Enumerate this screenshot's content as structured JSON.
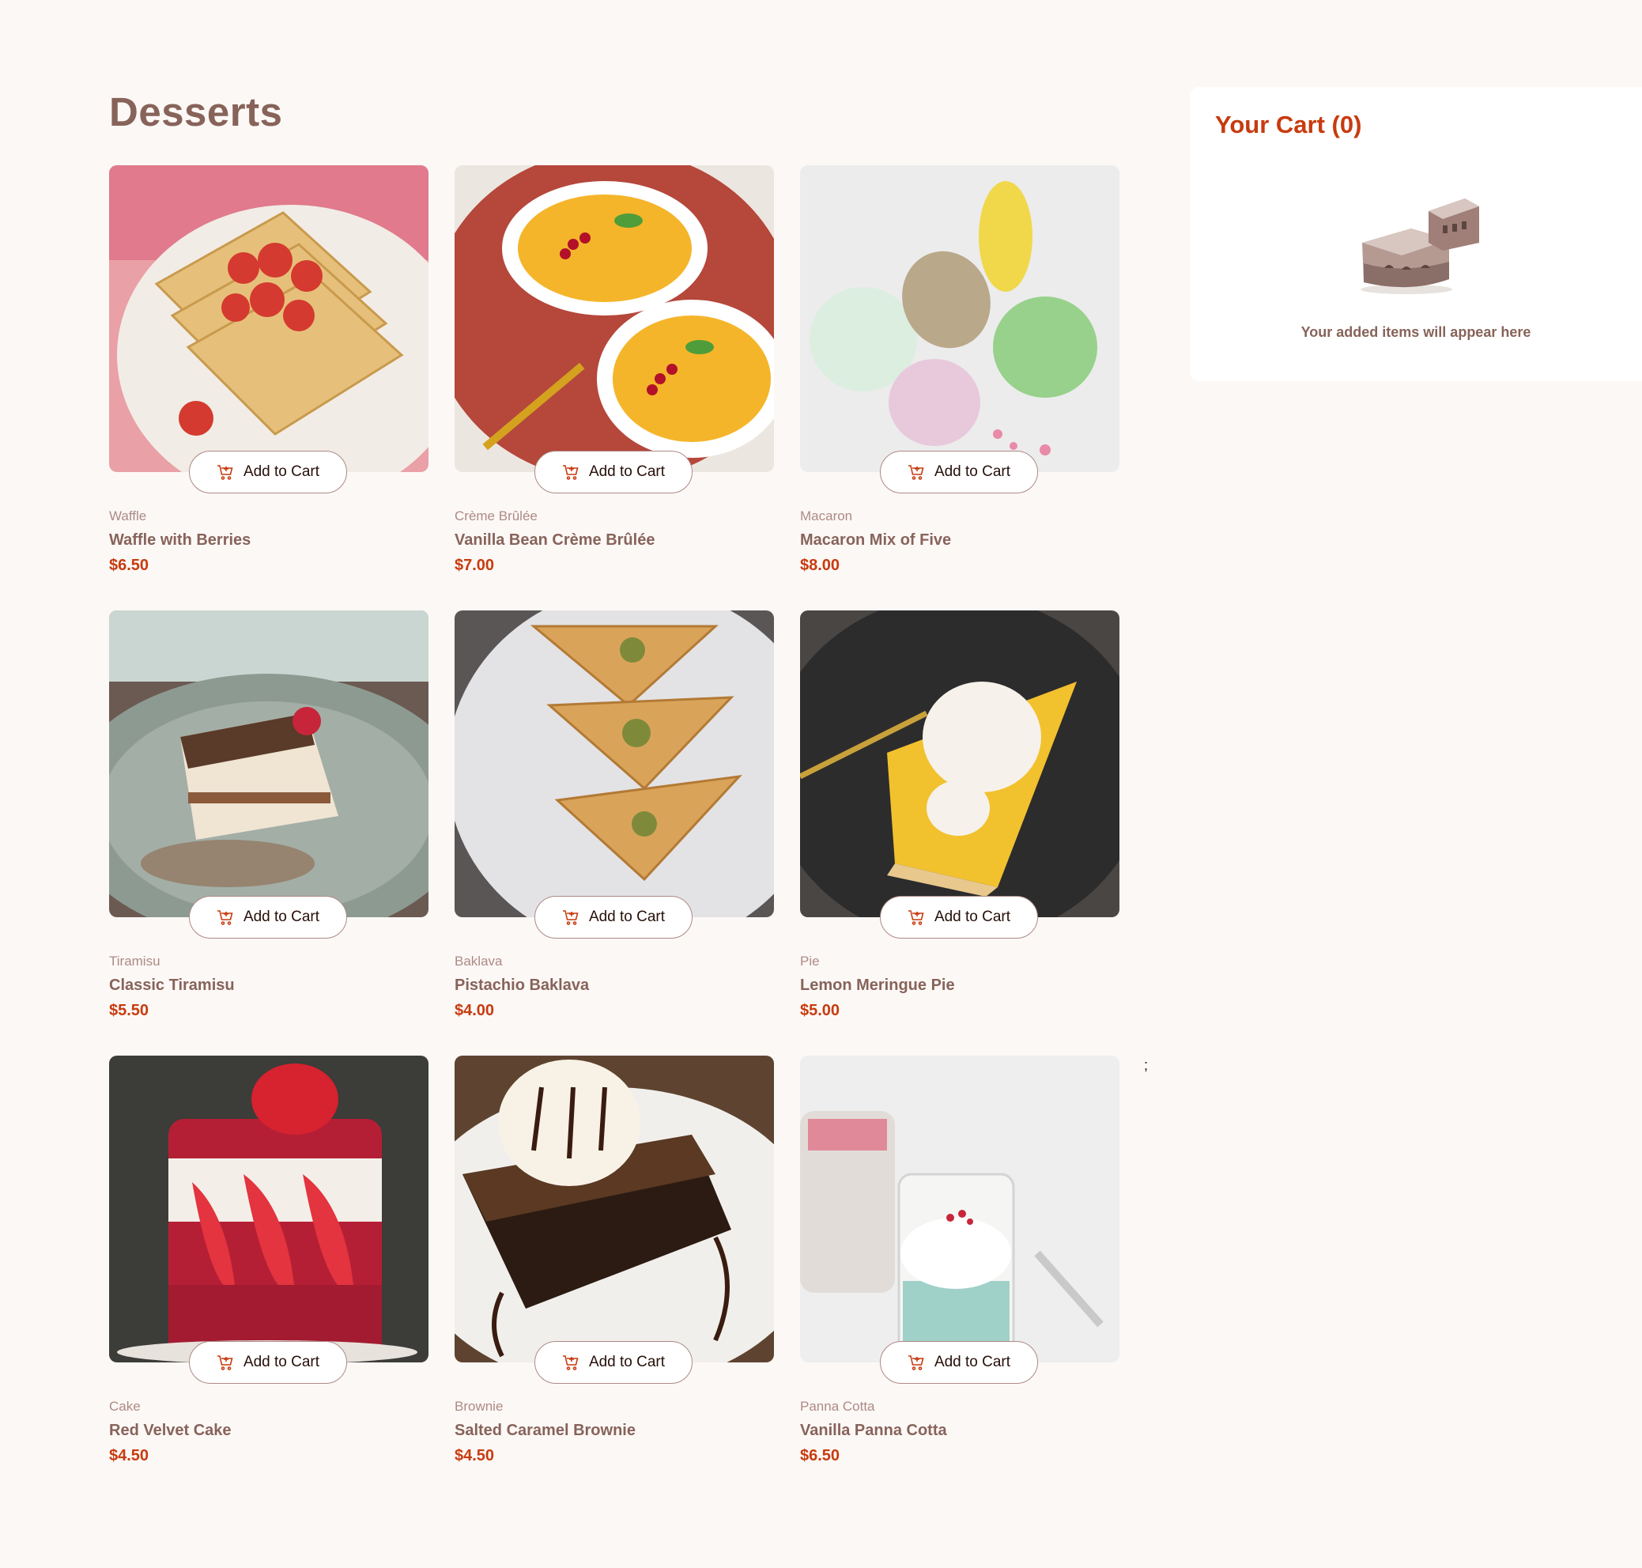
{
  "header": {
    "title": "Desserts"
  },
  "products": [
    {
      "category": "Waffle",
      "name": "Waffle with Berries",
      "price": "$6.50",
      "button_label": "Add to Cart"
    },
    {
      "category": "Crème Brûlée",
      "name": "Vanilla Bean Crème Brûlée",
      "price": "$7.00",
      "button_label": "Add to Cart"
    },
    {
      "category": "Macaron",
      "name": "Macaron Mix of Five",
      "price": "$8.00",
      "button_label": "Add to Cart"
    },
    {
      "category": "Tiramisu",
      "name": "Classic Tiramisu",
      "price": "$5.50",
      "button_label": "Add to Cart"
    },
    {
      "category": "Baklava",
      "name": "Pistachio Baklava",
      "price": "$4.00",
      "button_label": "Add to Cart"
    },
    {
      "category": "Pie",
      "name": "Lemon Meringue Pie",
      "price": "$5.00",
      "button_label": "Add to Cart"
    },
    {
      "category": "Cake",
      "name": "Red Velvet Cake",
      "price": "$4.50",
      "button_label": "Add to Cart"
    },
    {
      "category": "Brownie",
      "name": "Salted Caramel Brownie",
      "price": "$4.50",
      "button_label": "Add to Cart"
    },
    {
      "category": "Panna Cotta",
      "name": "Vanilla Panna Cotta",
      "price": "$6.50",
      "button_label": "Add to Cart"
    }
  ],
  "cart": {
    "title": "Your Cart (0)",
    "empty_message": "Your added items will appear here",
    "empty_icon": "cake-slice-illustration"
  },
  "stray_text": ";",
  "colors": {
    "background": "#fcf8f6",
    "accent": "#c73b0f",
    "heading": "#87635a",
    "muted": "#ad8a85",
    "text_dark": "#260f08"
  },
  "icons": {
    "add_to_cart": "add-to-cart-icon"
  }
}
